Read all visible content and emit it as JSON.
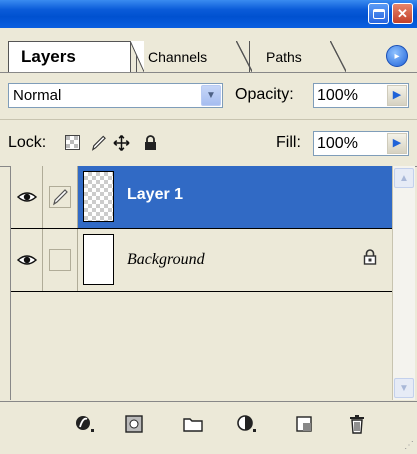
{
  "titlebar": {
    "minimize_icon": "minimize-icon",
    "close_glyph": "✕"
  },
  "tabs": [
    {
      "label": "Layers",
      "active": true
    },
    {
      "label": "Channels",
      "active": false
    },
    {
      "label": "Paths",
      "active": false
    }
  ],
  "menu_icon": "▸",
  "blend": {
    "mode": "Normal",
    "opacity_label": "Opacity:",
    "opacity_value": "100%"
  },
  "lock": {
    "label": "Lock:",
    "icons": [
      "lock-transparent-icon",
      "lock-image-icon",
      "lock-position-icon",
      "lock-all-icon"
    ],
    "fill_label": "Fill:",
    "fill_value": "100%"
  },
  "layers": [
    {
      "name": "Layer 1",
      "visible": true,
      "selected": true,
      "thumbnail": "transparent",
      "linked_brush": true
    },
    {
      "name": "Background",
      "visible": true,
      "selected": false,
      "thumbnail": "white",
      "locked": true
    }
  ],
  "toolbar_icons": [
    "add-layer-style-icon",
    "add-mask-icon",
    "new-group-icon",
    "new-adjustment-layer-icon",
    "new-layer-icon",
    "delete-layer-icon"
  ],
  "colors": {
    "selection": "#316AC5",
    "title_bar": "#0A5BD8",
    "panel": "#ECE9D8"
  }
}
